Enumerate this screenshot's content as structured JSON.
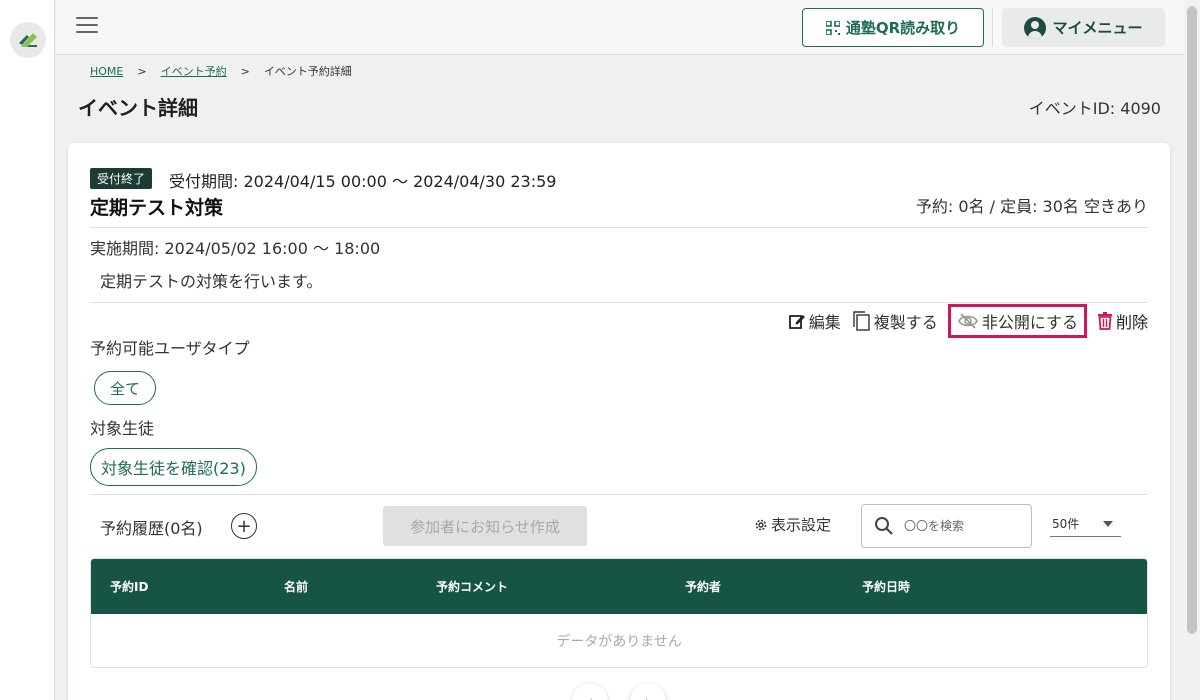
{
  "header": {
    "qr_button_label": "通塾QR読み取り",
    "menu_button_label": "マイメニュー"
  },
  "breadcrumb": {
    "home": "HOME",
    "separator": ">",
    "event_booking": "イベント予約",
    "current": "イベント予約詳細"
  },
  "page": {
    "title": "イベント詳細",
    "event_id_text": "イベントID: 4090"
  },
  "event": {
    "status_badge": "受付終了",
    "reception_period": "受付期間: 2024/04/15 00:00 〜 2024/04/30 23:59",
    "name": "定期テスト対策",
    "capacity": "予約: 0名 / 定員: 30名 空きあり",
    "execution_period": "実施期間: 2024/05/02 16:00 〜 18:00",
    "description": "定期テストの対策を行います。"
  },
  "actions": {
    "edit": "編集",
    "duplicate": "複製する",
    "unpublish": "非公開にする",
    "delete": "削除"
  },
  "user_types": {
    "label": "予約可能ユーザタイプ",
    "chip": "全て"
  },
  "students": {
    "label": "対象生徒",
    "button": "対象生徒を確認(23)"
  },
  "history": {
    "label": "予約履歴(0名)",
    "notify_button": "参加者にお知らせ作成",
    "display_settings": "表示設定",
    "search_placeholder": "〇〇を検索",
    "per_page": "50件"
  },
  "table": {
    "columns": [
      "予約ID",
      "名前",
      "予約コメント",
      "予約者",
      "予約日時"
    ],
    "empty_text": "データがありません"
  },
  "colors": {
    "primary": "#1f6b56",
    "table_header": "#165546",
    "highlight": "#d1165e",
    "delete": "#d1165e"
  }
}
